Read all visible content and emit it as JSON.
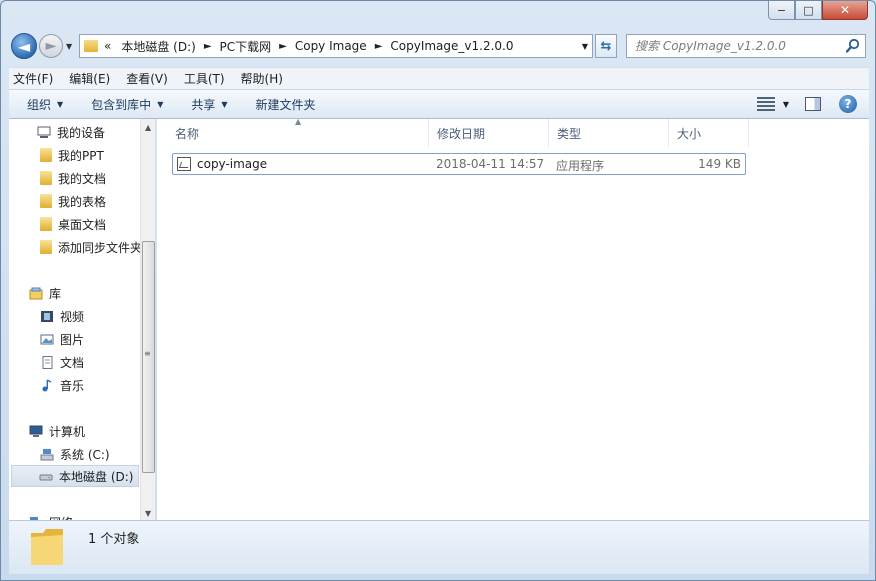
{
  "window": {
    "caption_buttons": {
      "minimize": "−",
      "maximize": "□",
      "close": "✕"
    }
  },
  "nav_buttons": {
    "back": "◄",
    "forward": "►",
    "history": "▼"
  },
  "address": {
    "prefix": "«",
    "crumbs": [
      "本地磁盘 (D:)",
      "PC下载网",
      "Copy Image",
      "CopyImage_v1.2.0.0"
    ],
    "separator": "►",
    "dropdown": "▼",
    "refresh": "⇆"
  },
  "search": {
    "placeholder": "搜索 CopyImage_v1.2.0.0"
  },
  "menu": [
    "文件(F)",
    "编辑(E)",
    "查看(V)",
    "工具(T)",
    "帮助(H)"
  ],
  "toolbar": {
    "organize": "组织",
    "include_library": "包含到库中",
    "share": "共享",
    "new_folder": "新建文件夹",
    "arrow": "▼"
  },
  "nav_pane": {
    "items": [
      {
        "label": "我的设备",
        "icon": "device-icon"
      },
      {
        "label": "我的PPT",
        "icon": "folder-icon"
      },
      {
        "label": "我的文档",
        "icon": "folder-icon"
      },
      {
        "label": "我的表格",
        "icon": "folder-icon"
      },
      {
        "label": "桌面文档",
        "icon": "folder-icon"
      },
      {
        "label": "添加同步文件夹",
        "icon": "folder-icon"
      },
      {
        "label": "库",
        "icon": "library-icon"
      },
      {
        "label": "视频",
        "icon": "video-icon"
      },
      {
        "label": "图片",
        "icon": "pictures-icon"
      },
      {
        "label": "文档",
        "icon": "documents-icon"
      },
      {
        "label": "音乐",
        "icon": "music-icon"
      },
      {
        "label": "计算机",
        "icon": "computer-icon"
      },
      {
        "label": "系统 (C:)",
        "icon": "drive-c-icon"
      },
      {
        "label": "本地磁盘 (D:)",
        "icon": "drive-d-icon"
      },
      {
        "label": "网络",
        "icon": "network-icon"
      }
    ],
    "scroll_up": "▲",
    "scroll_down": "▼",
    "grip": "≡"
  },
  "columns": {
    "name": "名称",
    "modified": "修改日期",
    "type": "类型",
    "size": "大小",
    "sort_arrow": "▲"
  },
  "files": [
    {
      "name": "copy-image",
      "modified": "2018-04-11 14:57",
      "type": "应用程序",
      "size": "149 KB"
    }
  ],
  "status": {
    "text": "1 个对象"
  },
  "help": "?"
}
